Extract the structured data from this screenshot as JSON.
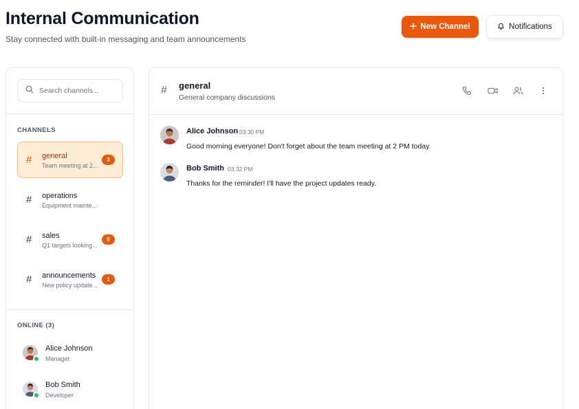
{
  "header": {
    "title": "Internal Communication",
    "subtitle": "Stay connected with built-in messaging and team announcements",
    "new_channel_label": "New Channel",
    "notifications_label": "Notifications"
  },
  "sidebar": {
    "search_placeholder": "Search channels...",
    "channels_heading": "CHANNELS",
    "channels": [
      {
        "name": "general",
        "preview": "Team meeting at 2...",
        "unread": "3",
        "active": true
      },
      {
        "name": "operations",
        "preview": "Equipment mainte...",
        "unread": "",
        "active": false
      },
      {
        "name": "sales",
        "preview": "Q1 targets looking...",
        "unread": "5",
        "active": false
      },
      {
        "name": "announcements",
        "preview": "New policy update...",
        "unread": "1",
        "active": false
      }
    ],
    "online_heading": "ONLINE (3)",
    "online_users": [
      {
        "name": "Alice Johnson",
        "role": "Manager"
      },
      {
        "name": "Bob Smith",
        "role": "Developer"
      }
    ]
  },
  "chat": {
    "channel_name": "general",
    "channel_description": "General company discussions",
    "messages": [
      {
        "author": "Alice Johnson",
        "time": "03:30 PM",
        "text": "Good morning everyone! Don't forget about the team meeting at 2 PM today."
      },
      {
        "author": "Bob Smith",
        "time": "03:32 PM",
        "text": "Thanks for the reminder! I'll have the project updates ready."
      }
    ]
  },
  "colors": {
    "accent": "#ea580c",
    "active_channel_bg": "#ffedd5",
    "online": "#22c55e"
  }
}
